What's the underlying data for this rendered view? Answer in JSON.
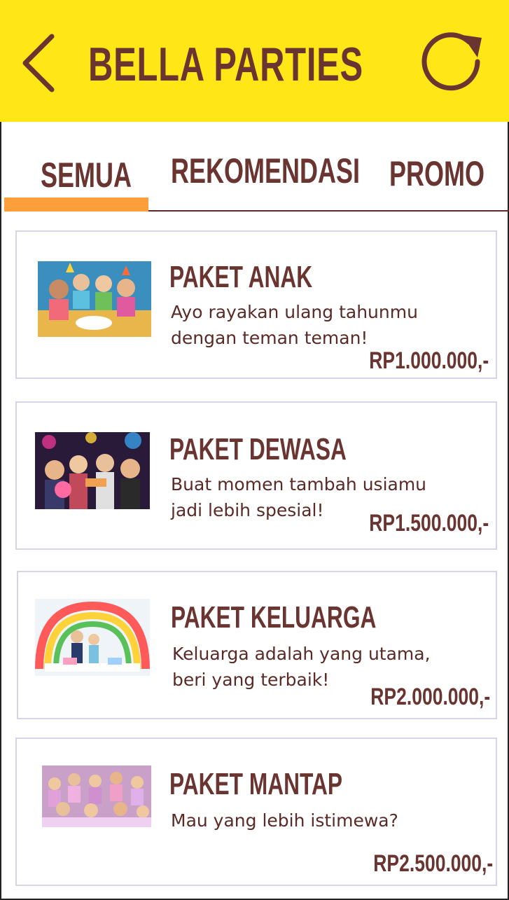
{
  "header": {
    "title": "BELLA PARTIES",
    "back_icon": "chevron-left-icon",
    "refresh_icon": "refresh-icon",
    "background": "#ffe617",
    "text_color": "#6a3530"
  },
  "tabs": {
    "items": [
      {
        "label": "SEMUA",
        "active": true
      },
      {
        "label": "REKOMENDASI",
        "active": false
      },
      {
        "label": "PROMO",
        "active": false
      }
    ],
    "indicator_color": "#ff9f3b"
  },
  "packages": [
    {
      "title": "PAKET ANAK",
      "description": "Ayo rayakan ulang tahunmu dengan teman teman!",
      "price": "RP1.000.000,-",
      "image": "kids-party-photo"
    },
    {
      "title": "PAKET DEWASA",
      "description": "Buat momen tambah usiamu jadi lebih spesial!",
      "price": "RP1.500.000,-",
      "image": "adult-party-photo"
    },
    {
      "title": "PAKET KELUARGA",
      "description": "Keluarga adalah yang utama, beri yang terbaik!",
      "price": "RP2.000.000,-",
      "image": "family-party-photo"
    },
    {
      "title": "PAKET MANTAP",
      "description": "Mau yang lebih istimewa?",
      "price": "RP2.500.000,-",
      "image": "pajama-party-photo"
    }
  ]
}
